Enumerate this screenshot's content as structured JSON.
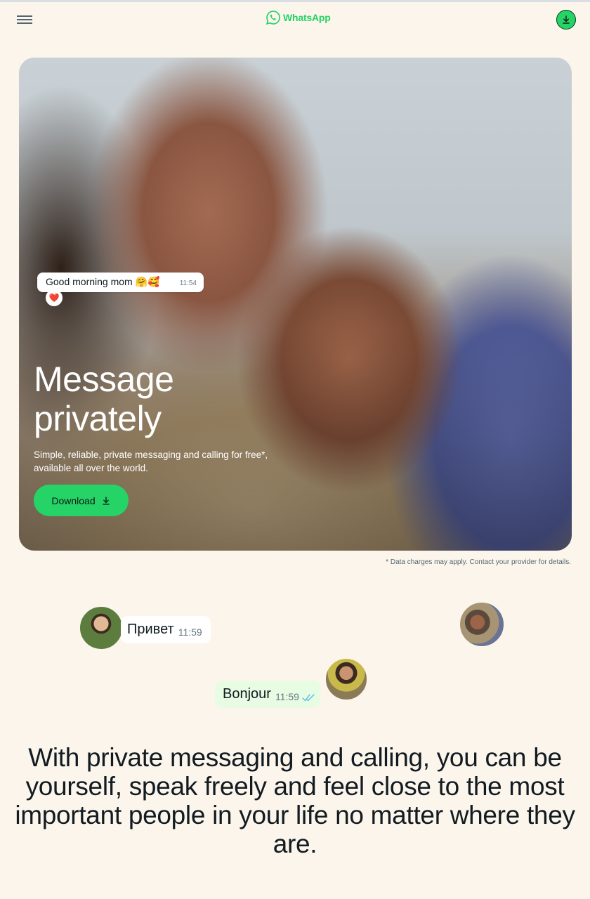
{
  "header": {
    "brand": "WhatsApp",
    "icons": {
      "menu": "hamburger-menu-icon",
      "logo": "whatsapp-logo-icon",
      "download": "download-arrow-icon"
    }
  },
  "hero": {
    "chat_message": "Good morning mom 🤗🥰",
    "chat_time": "11:54",
    "reaction": "❤️",
    "title_line1": "Message",
    "title_line2": "privately",
    "subtitle": "Simple, reliable, private messaging and calling for free*, available all over the world.",
    "download_label": "Download"
  },
  "disclaimer": "* Data charges may apply. Contact your provider for details.",
  "chats": {
    "ru_text": "Привет",
    "ru_time": "11:59",
    "fr_text": "Bonjour",
    "fr_time": "11:59"
  },
  "tagline": "With private messaging and calling, you can be yourself, speak freely and feel close to the most important people in your life no matter where they are.",
  "colors": {
    "brand_green": "#25d366",
    "background": "#fcf5eb",
    "outgoing_bubble": "#e7fce3",
    "read_ticks": "#53bdeb"
  }
}
